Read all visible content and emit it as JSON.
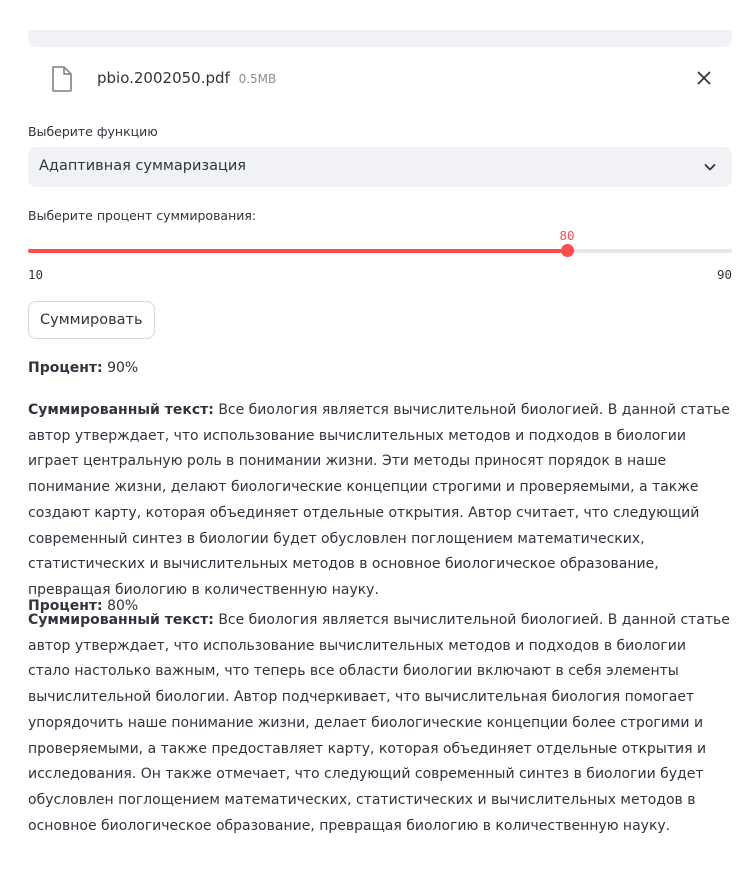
{
  "uploader": {
    "file_name": "pbio.2002050.pdf",
    "file_size": "0.5MB"
  },
  "function_select": {
    "label": "Выберите функцию",
    "value": "Адаптивная суммаризация"
  },
  "slider": {
    "label": "Выберите процент суммирования:",
    "value": 80,
    "value_text": "80",
    "min": 10,
    "min_text": "10",
    "max": 90,
    "max_text": "90",
    "accent_color": "#ff4b4b"
  },
  "summarize_button": {
    "label": "Суммировать"
  },
  "results": [
    {
      "percent_label": "Процент:",
      "percent_value": "90%",
      "text_label": "Суммированный текст:",
      "text": "Все биология является вычислительной биологией. В данной статье автор утверждает, что использование вычислительных методов и подходов в биологии играет центральную роль в понимании жизни. Эти методы приносят порядок в наше понимание жизни, делают биологические концепции строгими и проверяемыми, а также создают карту, которая объединяет отдельные открытия. Автор считает, что следующий современный синтез в биологии будет обусловлен поглощением математических, статистических и вычислительных методов в основное биологическое образование, превращая биологию в количественную науку."
    },
    {
      "percent_label": "Процент:",
      "percent_value": "80%",
      "text_label": "Суммированный текст:",
      "text": "Все биология является вычислительной биологией. В данной статье автор утверждает, что использование вычислительных методов и подходов в биологии стало настолько важным, что теперь все области биологии включают в себя элементы вычислительной биологии. Автор подчеркивает, что вычислительная биология помогает упорядочить наше понимание жизни, делает биологические концепции более строгими и проверяемыми, а также предоставляет карту, которая объединяет отдельные открытия и исследования. Он также отмечает, что следующий современный синтез в биологии будет обусловлен поглощением математических, статистических и вычислительных методов в основное биологическое образование, превращая биологию в количественную науку."
    }
  ]
}
